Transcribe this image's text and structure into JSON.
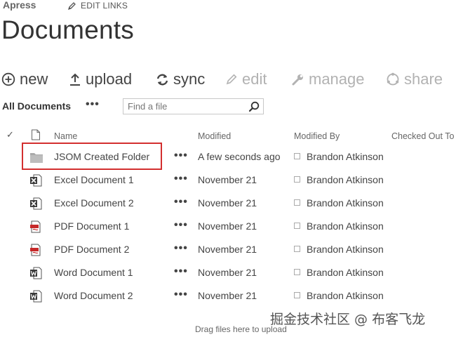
{
  "top": {
    "site_name": "Apress",
    "edit_links": "EDIT LINKS"
  },
  "page_title": "Documents",
  "command_bar": {
    "new": "new",
    "upload": "upload",
    "sync": "sync",
    "edit": "edit",
    "manage": "manage",
    "share": "share"
  },
  "view": {
    "name": "All Documents",
    "ellipsis": "•••",
    "search_placeholder": "Find a file"
  },
  "columns": {
    "name": "Name",
    "modified": "Modified",
    "modified_by": "Modified By",
    "checked_out_to": "Checked Out To"
  },
  "rows": [
    {
      "type": "folder",
      "name": "JSOM Created Folder",
      "ellipsis": "•••",
      "modified": "A few seconds ago",
      "modified_by": "Brandon Atkinson"
    },
    {
      "type": "excel",
      "name": "Excel Document 1",
      "ellipsis": "•••",
      "modified": "November 21",
      "modified_by": "Brandon Atkinson"
    },
    {
      "type": "excel",
      "name": "Excel Document 2",
      "ellipsis": "•••",
      "modified": "November 21",
      "modified_by": "Brandon Atkinson"
    },
    {
      "type": "pdf",
      "name": "PDF Document 1",
      "ellipsis": "•••",
      "modified": "November 21",
      "modified_by": "Brandon Atkinson"
    },
    {
      "type": "pdf",
      "name": "PDF Document 2",
      "ellipsis": "•••",
      "modified": "November 21",
      "modified_by": "Brandon Atkinson"
    },
    {
      "type": "word",
      "name": "Word Document 1",
      "ellipsis": "•••",
      "modified": "November 21",
      "modified_by": "Brandon Atkinson"
    },
    {
      "type": "word",
      "name": "Word Document 2",
      "ellipsis": "•••",
      "modified": "November 21",
      "modified_by": "Brandon Atkinson"
    }
  ],
  "drag_hint": "Drag files here to upload",
  "watermark": "掘金技术社区 @ 布客飞龙",
  "colors": {
    "highlight_border": "#d32f2f",
    "text": "#444444",
    "disabled": "#b2b2b2"
  }
}
